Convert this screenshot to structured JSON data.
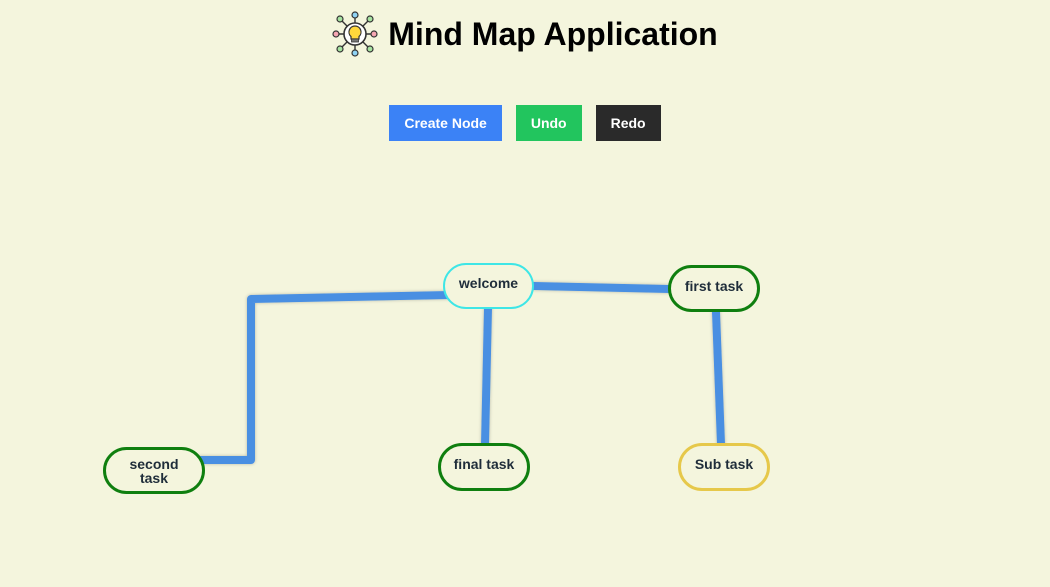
{
  "app": {
    "title": "Mind Map Application",
    "logo_icon": "lightbulb-network-icon"
  },
  "toolbar": {
    "create_label": "Create Node",
    "undo_label": "Undo",
    "redo_label": "Redo",
    "create_color": "#3b82f6",
    "undo_color": "#22c55e",
    "redo_color": "#2a2a2a"
  },
  "colors": {
    "background": "#f4f5dd",
    "connector": "#4a8fe2",
    "border_green": "#0f7f0f",
    "border_cyan": "#3ee6e6",
    "border_yellow": "#e6c84a"
  },
  "mindmap": {
    "nodes": [
      {
        "id": "welcome",
        "label": "welcome",
        "border": "cyan"
      },
      {
        "id": "first",
        "label": "first task",
        "border": "green"
      },
      {
        "id": "second",
        "label": "second task",
        "border": "green"
      },
      {
        "id": "final",
        "label": "final task",
        "border": "green"
      },
      {
        "id": "sub",
        "label": "Sub task",
        "border": "yellow"
      }
    ],
    "edges": [
      {
        "from": "welcome",
        "to": "first"
      },
      {
        "from": "welcome",
        "to": "second"
      },
      {
        "from": "welcome",
        "to": "final"
      },
      {
        "from": "first",
        "to": "sub"
      }
    ]
  }
}
